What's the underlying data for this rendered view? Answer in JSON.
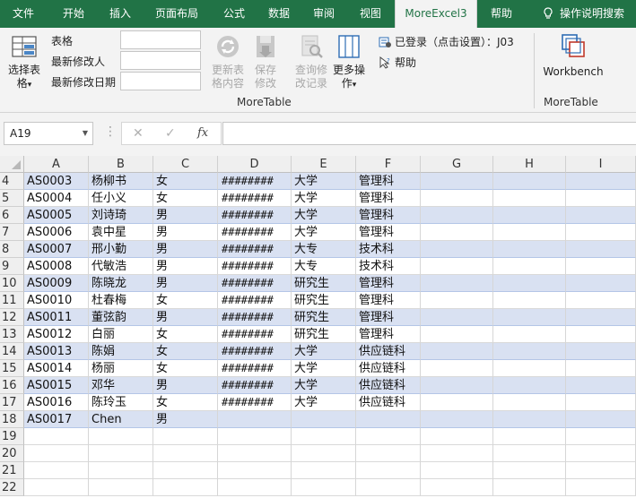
{
  "ribbon_tabs": [
    {
      "label": "文件"
    },
    {
      "label": "开始"
    },
    {
      "label": "插入"
    },
    {
      "label": "页面布局"
    },
    {
      "label": "公式"
    },
    {
      "label": "数据"
    },
    {
      "label": "审阅"
    },
    {
      "label": "视图"
    },
    {
      "label": "MoreExcel3",
      "active": true
    },
    {
      "label": "帮助"
    },
    {
      "label": "操作说明搜索",
      "icon": "lightbulb-icon"
    }
  ],
  "ribbon": {
    "select_table": {
      "line1": "选择表",
      "line2": "格",
      "arrow": "▾"
    },
    "field_labels": [
      "表格",
      "最新修改人",
      "最新修改日期"
    ],
    "refresh": {
      "line1": "更新表",
      "line2": "格内容"
    },
    "save": {
      "line1": "保存",
      "line2": "修改"
    },
    "query": {
      "line1": "查询修",
      "line2": "改记录"
    },
    "more": {
      "line1": "更多操",
      "line2": "作",
      "arrow": "▾"
    },
    "login_status": "已登录（点击设置）：J03",
    "help": "帮助",
    "group_moretable": "MoreTable",
    "workbench": "Workbench",
    "group_moretable2": "MoreTable"
  },
  "formula_bar": {
    "name_box": "A19",
    "cancel_glyph": "✕",
    "enter_glyph": "✓",
    "fx_glyph": "fx",
    "formula": ""
  },
  "columns": [
    "A",
    "B",
    "C",
    "D",
    "E",
    "F",
    "G",
    "H",
    "I"
  ],
  "rows": [
    {
      "num": "4",
      "cells": [
        "AS0003",
        "杨柳书",
        "女",
        "########",
        "大学",
        "管理科"
      ]
    },
    {
      "num": "5",
      "cells": [
        "AS0004",
        "任小义",
        "女",
        "########",
        "大学",
        "管理科"
      ]
    },
    {
      "num": "6",
      "cells": [
        "AS0005",
        "刘诗琦",
        "男",
        "########",
        "大学",
        "管理科"
      ]
    },
    {
      "num": "7",
      "cells": [
        "AS0006",
        "袁中星",
        "男",
        "########",
        "大学",
        "管理科"
      ]
    },
    {
      "num": "8",
      "cells": [
        "AS0007",
        "邢小勤",
        "男",
        "########",
        "大专",
        "技术科"
      ]
    },
    {
      "num": "9",
      "cells": [
        "AS0008",
        "代敏浩",
        "男",
        "########",
        "大专",
        "技术科"
      ]
    },
    {
      "num": "10",
      "cells": [
        "AS0009",
        "陈晓龙",
        "男",
        "########",
        "研究生",
        "管理科"
      ]
    },
    {
      "num": "11",
      "cells": [
        "AS0010",
        "杜春梅",
        "女",
        "########",
        "研究生",
        "管理科"
      ]
    },
    {
      "num": "12",
      "cells": [
        "AS0011",
        "董弦韵",
        "男",
        "########",
        "研究生",
        "管理科"
      ]
    },
    {
      "num": "13",
      "cells": [
        "AS0012",
        "白丽",
        "女",
        "########",
        "研究生",
        "管理科"
      ]
    },
    {
      "num": "14",
      "cells": [
        "AS0013",
        "陈娟",
        "女",
        "########",
        "大学",
        "供应链科"
      ]
    },
    {
      "num": "15",
      "cells": [
        "AS0014",
        "杨丽",
        "女",
        "########",
        "大学",
        "供应链科"
      ]
    },
    {
      "num": "16",
      "cells": [
        "AS0015",
        "邓华",
        "男",
        "########",
        "大学",
        "供应链科"
      ]
    },
    {
      "num": "17",
      "cells": [
        "AS0016",
        "陈玲玉",
        "女",
        "########",
        "大学",
        "供应链科"
      ]
    },
    {
      "num": "18",
      "cells": [
        "AS0017",
        "Chen",
        "男",
        "",
        "",
        ""
      ]
    },
    {
      "num": "19",
      "cells": [
        "",
        "",
        "",
        "",
        "",
        ""
      ]
    },
    {
      "num": "20",
      "cells": [
        "",
        "",
        "",
        "",
        "",
        ""
      ]
    },
    {
      "num": "21",
      "cells": [
        "",
        "",
        "",
        "",
        "",
        ""
      ]
    },
    {
      "num": "22",
      "cells": [
        "",
        "",
        "",
        "",
        "",
        ""
      ]
    }
  ]
}
